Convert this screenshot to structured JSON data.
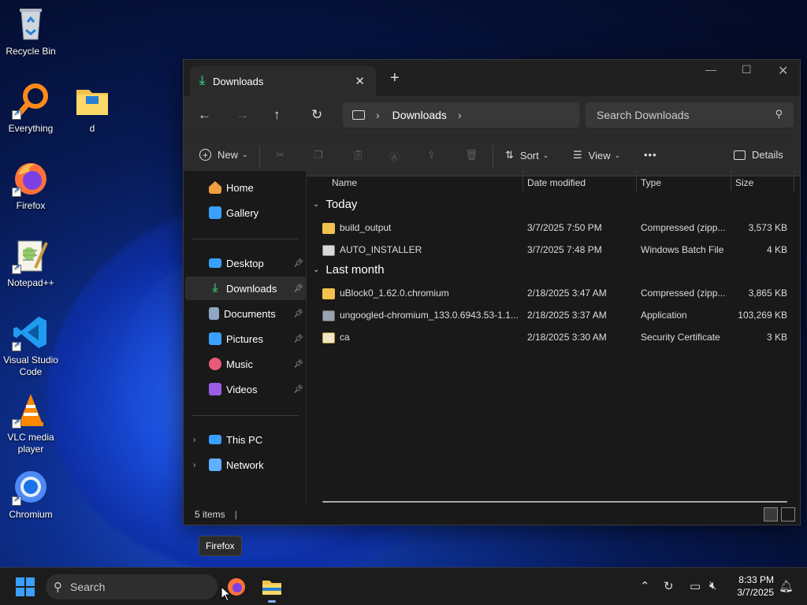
{
  "desktop": {
    "icons": [
      {
        "label": "Recycle Bin"
      },
      {
        "label": "Everything"
      },
      {
        "label": "d"
      },
      {
        "label": "Firefox"
      },
      {
        "label": "Notepad++"
      },
      {
        "label": "Visual Studio Code"
      },
      {
        "label": "VLC media player"
      },
      {
        "label": "Chromium"
      }
    ]
  },
  "window": {
    "tab_title": "Downloads",
    "new_tab": "+",
    "address": {
      "root": "This PC",
      "crumbs": [
        "Downloads"
      ]
    },
    "search_placeholder": "Search Downloads",
    "toolbar": {
      "new_label": "New",
      "sort_label": "Sort",
      "view_label": "View",
      "more_label": "•••",
      "details_label": "Details"
    },
    "nav": {
      "home": "Home",
      "gallery": "Gallery",
      "desktop": "Desktop",
      "downloads": "Downloads",
      "documents": "Documents",
      "pictures": "Pictures",
      "music": "Music",
      "videos": "Videos",
      "this_pc": "This PC",
      "network": "Network"
    },
    "columns": {
      "name": "Name",
      "date": "Date modified",
      "type": "Type",
      "size": "Size"
    },
    "groups": [
      {
        "label": "Today",
        "files": [
          {
            "name": "build_output",
            "date": "3/7/2025 7:50 PM",
            "type": "Compressed (zipp...",
            "size": "3,573 KB",
            "icon": "zip-folder-icon"
          },
          {
            "name": "AUTO_INSTALLER",
            "date": "3/7/2025 7:48 PM",
            "type": "Windows Batch File",
            "size": "4 KB",
            "icon": "batch-file-icon"
          }
        ]
      },
      {
        "label": "Last month",
        "files": [
          {
            "name": "uBlock0_1.62.0.chromium",
            "date": "2/18/2025 3:47 AM",
            "type": "Compressed (zipp...",
            "size": "3,865 KB",
            "icon": "zip-folder-icon"
          },
          {
            "name": "ungoogled-chromium_133.0.6943.53-1.1...",
            "date": "2/18/2025 3:37 AM",
            "type": "Application",
            "size": "103,269 KB",
            "icon": "application-icon"
          },
          {
            "name": "ca",
            "date": "2/18/2025 3:30 AM",
            "type": "Security Certificate",
            "size": "3 KB",
            "icon": "certificate-icon"
          }
        ]
      }
    ],
    "status": "5 items"
  },
  "tooltip": "Firefox",
  "taskbar": {
    "search_placeholder": "Search",
    "time": "8:33 PM",
    "date": "3/7/2025"
  },
  "colors": {
    "accent": "#3aa0ff",
    "download_green": "#2fb36c",
    "folder_yellow": "#f2c14e"
  }
}
